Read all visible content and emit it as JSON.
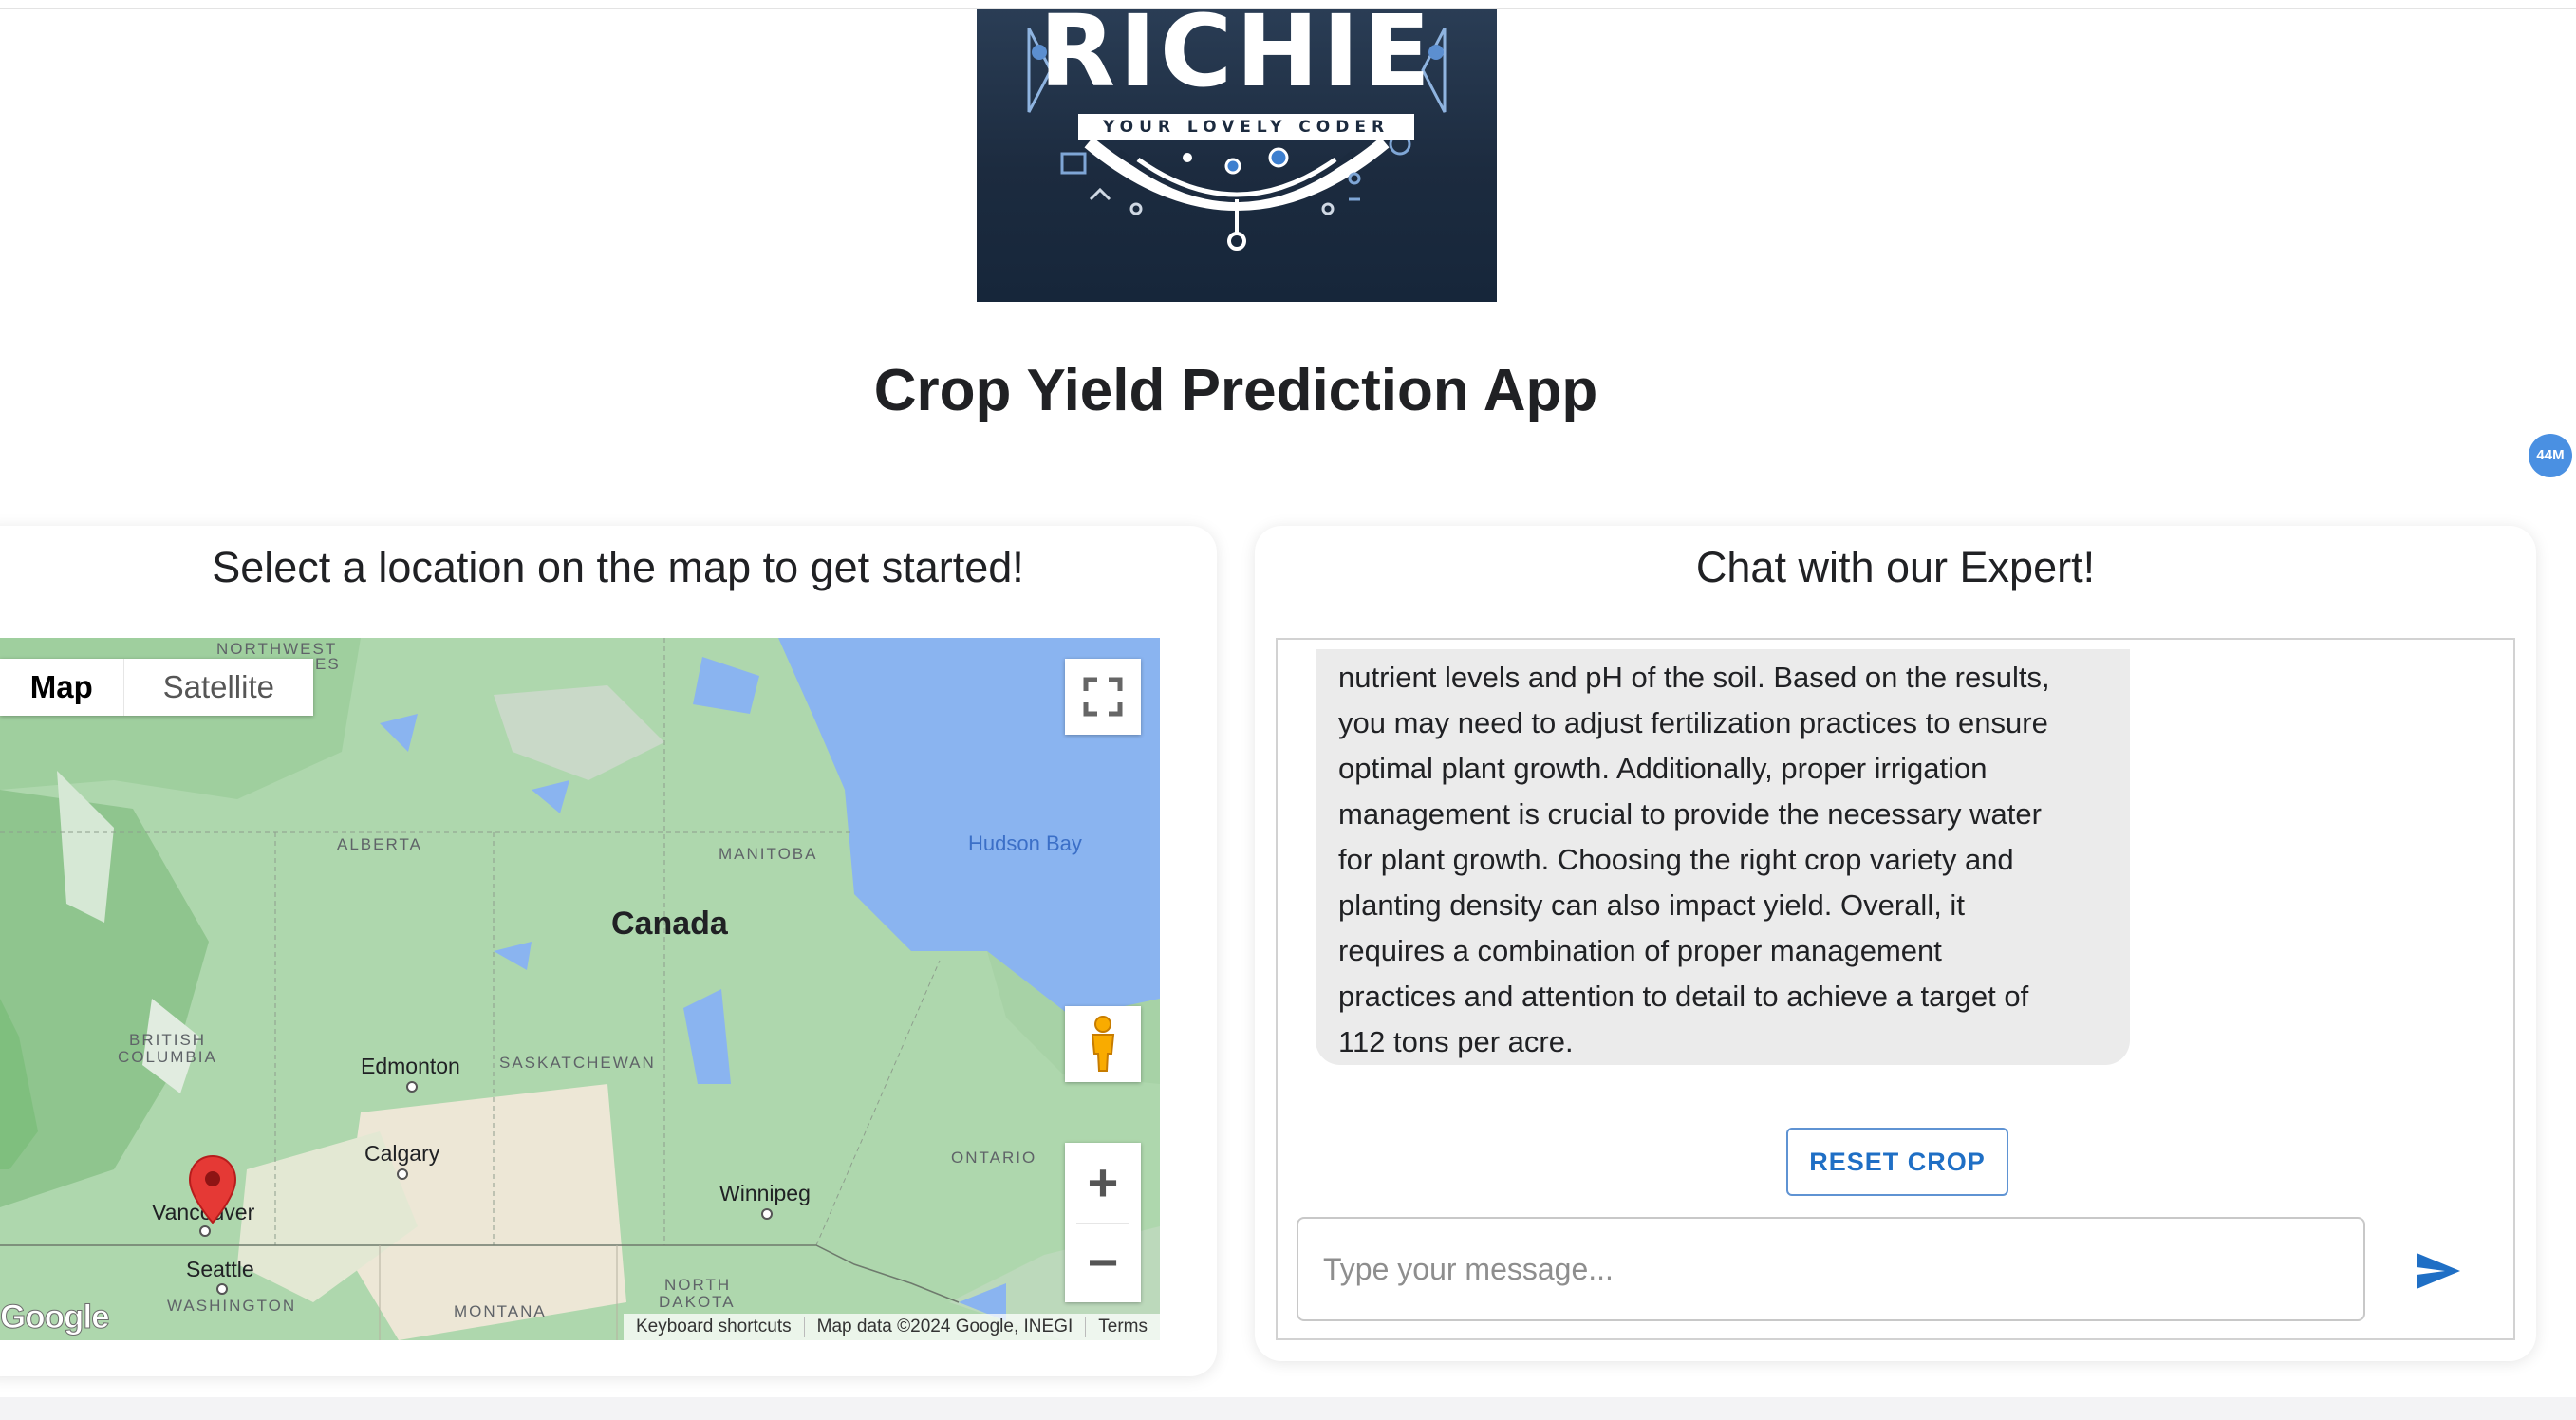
{
  "logo": {
    "word": "RICHIE",
    "tagline": "YOUR LOVELY CODER"
  },
  "header": {
    "title": "Crop Yield Prediction App"
  },
  "badge": {
    "label": "44M"
  },
  "map_card": {
    "title": "Select a location on the map to get started!",
    "map_type": {
      "map_label": "Map",
      "satellite_label": "Satellite",
      "selected": "Map"
    },
    "regions": [
      "NORTHWEST",
      "ES",
      "ALBERTA",
      "MANITOBA",
      "BRITISH",
      "COLUMBIA",
      "SASKATCHEWAN",
      "ONTARIO",
      "WASHINGTON",
      "MONTANA",
      "NORTH",
      "DAKOTA"
    ],
    "country": "Canada",
    "water": "Hudson Bay",
    "cities": [
      "Edmonton",
      "Calgary",
      "Winnipeg",
      "Vancouver",
      "Seattle"
    ],
    "google_logo": "Google",
    "attribution": {
      "shortcuts": "Keyboard shortcuts",
      "data": "Map data ©2024 Google, INEGI",
      "terms": "Terms"
    },
    "icons": {
      "fullscreen": "fullscreen-icon",
      "pegman": "pegman-icon",
      "zoom_in": "+",
      "zoom_out": "−",
      "marker": "map-marker-icon"
    }
  },
  "chat_card": {
    "title": "Chat with our Expert!",
    "messages": [
      {
        "role": "bot",
        "lines": [
          "nutrient levels and pH of the soil. Based on the results,",
          "you may need to adjust fertilization practices to ensure",
          "optimal plant growth. Additionally, proper irrigation",
          "management is crucial to provide the necessary water",
          "for plant growth. Choosing the right crop variety and",
          "planting density can also impact yield. Overall, it",
          "requires a combination of proper management",
          "practices and attention to detail to achieve a target of",
          "112 tons per acre."
        ]
      }
    ],
    "reset_label": "RESET CROP",
    "input_placeholder": "Type your message...",
    "send_icon": "send-icon",
    "accent": "#1f6fc5"
  }
}
